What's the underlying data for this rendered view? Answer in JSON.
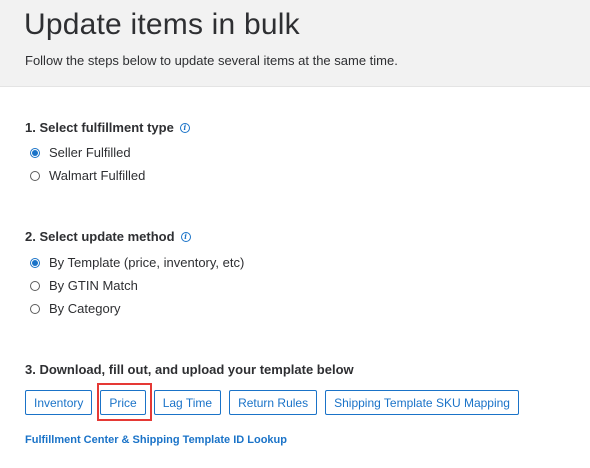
{
  "header": {
    "title": "Update items in bulk",
    "subtitle": "Follow the steps below to update several items at the same time."
  },
  "fulfillment": {
    "title": "1. Select fulfillment type",
    "info_icon": "info-icon",
    "options": [
      {
        "label": "Seller Fulfilled",
        "selected": true
      },
      {
        "label": "Walmart Fulfilled",
        "selected": false
      }
    ]
  },
  "method": {
    "title": "2. Select update method",
    "info_icon": "info-icon",
    "options": [
      {
        "label": "By Template (price, inventory, etc)",
        "selected": true
      },
      {
        "label": "By GTIN Match",
        "selected": false
      },
      {
        "label": "By Category",
        "selected": false
      }
    ]
  },
  "templates": {
    "title": "3. Download, fill out, and upload your template below",
    "buttons": [
      "Inventory",
      "Price",
      "Lag Time",
      "Return Rules",
      "Shipping Template SKU Mapping"
    ],
    "highlighted": "Price"
  },
  "lookup_link": "Fulfillment Center & Shipping Template ID Lookup",
  "colors": {
    "accent": "#1a73c8",
    "highlight": "#e53935",
    "header_bg": "#f2f2f2"
  }
}
